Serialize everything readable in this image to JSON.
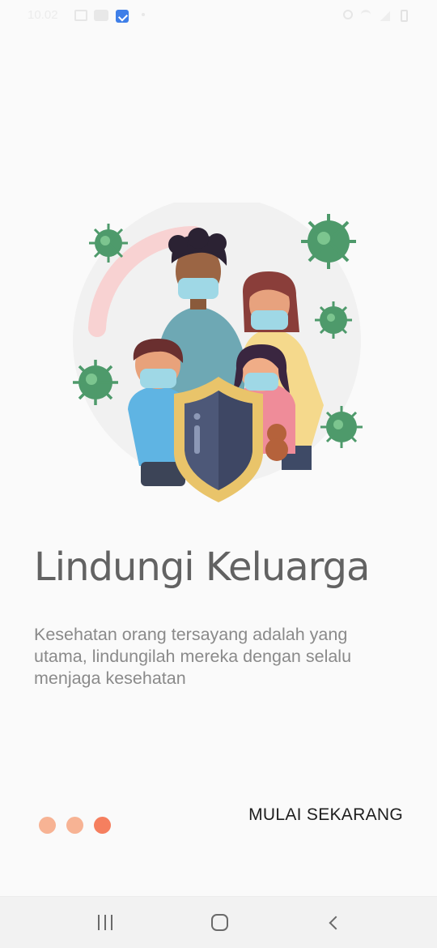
{
  "statusbar": {
    "time": "10.02",
    "icons": [
      "gallery-icon",
      "message-icon",
      "app-notification-icon",
      "dot-icon",
      "alarm-icon",
      "wifi-icon",
      "signal-icon",
      "battery-icon"
    ]
  },
  "onboarding": {
    "illustration": "family-wearing-masks-with-shield-illustration",
    "title": "Lindungi Keluarga",
    "description": "Kesehatan orang tersayang adalah yang utama, lindungilah mereka dengan selalu menjaga kesehatan",
    "page_count": 3,
    "active_page": 3,
    "start_label": "MULAI SEKARANG"
  },
  "colors": {
    "background": "#fafafa",
    "title": "#626262",
    "description": "#8a8a8a",
    "dot_inactive": "#f7b394",
    "dot_active": "#f57f5f",
    "shield": "#e9c46a",
    "virus": "#4e9a6b"
  },
  "navbar": {
    "icons": [
      "recent-apps-icon",
      "home-icon",
      "back-icon"
    ]
  }
}
